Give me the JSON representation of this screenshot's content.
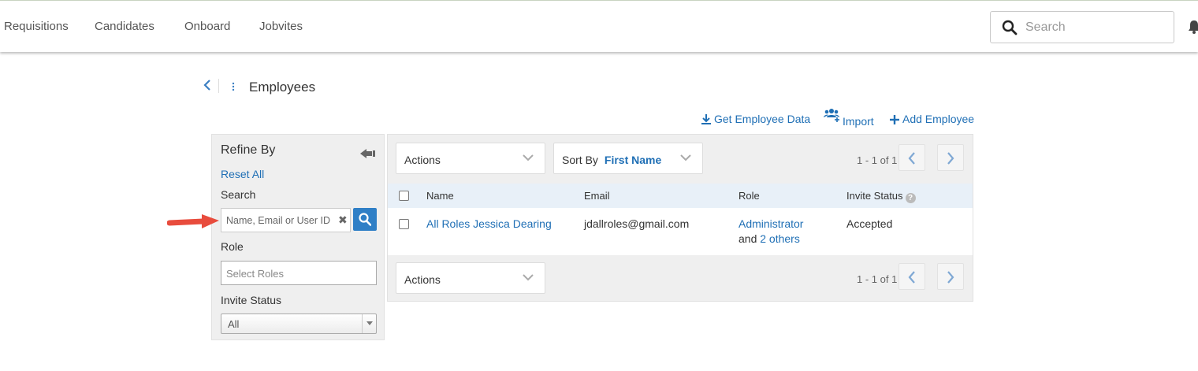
{
  "topnav": {
    "items": [
      "Requisitions",
      "Candidates",
      "Onboard",
      "Jobvites"
    ],
    "search_placeholder": "Search"
  },
  "page": {
    "title": "Employees",
    "actions": {
      "get_data": "Get Employee Data",
      "import": "Import",
      "add_employee": "Add Employee"
    }
  },
  "refine": {
    "title": "Refine By",
    "reset": "Reset All",
    "search_label": "Search",
    "search_placeholder": "Name, Email or User ID",
    "role_label": "Role",
    "role_placeholder": "Select Roles",
    "invite_status_label": "Invite Status",
    "invite_status_value": "All"
  },
  "table": {
    "actions_label": "Actions",
    "sort_by_label": "Sort By",
    "sort_by_value": "First Name",
    "pager_text": "1 - 1 of 1",
    "columns": [
      "Name",
      "Email",
      "Role",
      "Invite Status"
    ],
    "rows": [
      {
        "name": "All Roles Jessica Dearing",
        "email": "jdallroles@gmail.com",
        "role_primary": "Administrator",
        "role_and": "and",
        "role_others": "2 others",
        "invite_status": "Accepted"
      }
    ]
  },
  "colors": {
    "link": "#1f6fb5",
    "search_button": "#2f7fc6",
    "annotation_arrow": "#e84c3d",
    "header_row": "#e8f0f8"
  }
}
